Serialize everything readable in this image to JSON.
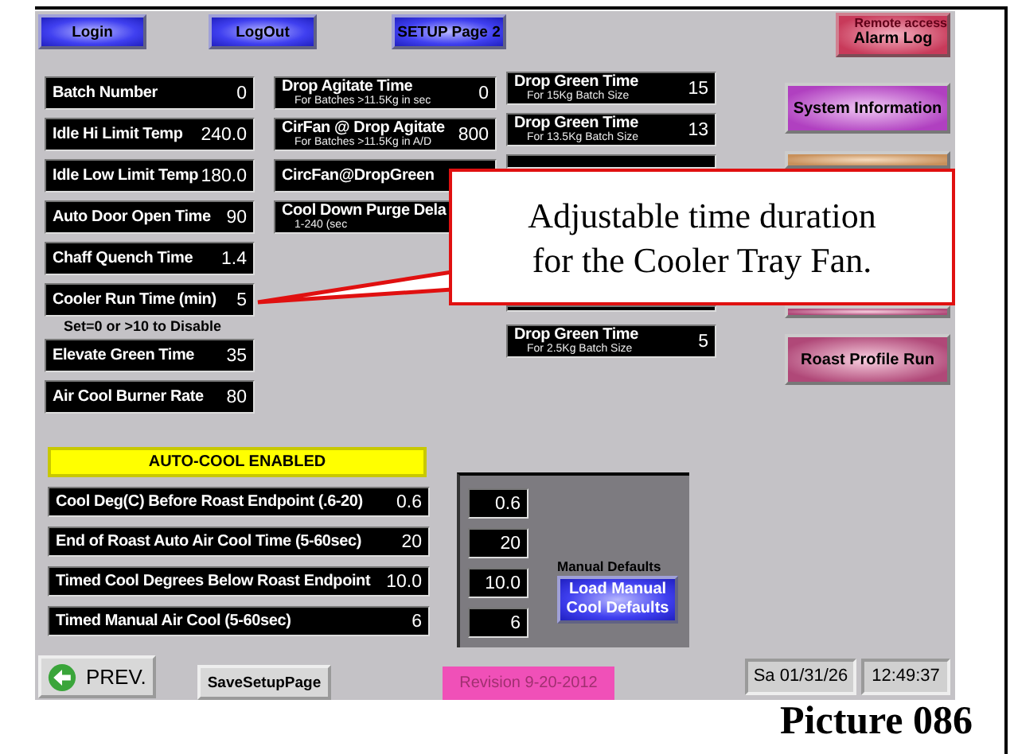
{
  "top_buttons": [
    {
      "label": "Login"
    },
    {
      "label": "LogOut"
    },
    {
      "label": "SETUP Page 2"
    }
  ],
  "alarm_button": {
    "caption": "Remote access",
    "label": "Alarm Log"
  },
  "settings_left": [
    {
      "label": "Batch Number",
      "value": "0"
    },
    {
      "label": "Idle Hi Limit Temp",
      "value": "240.0"
    },
    {
      "label": "Idle Low Limit Temp",
      "value": "180.0"
    },
    {
      "label": "Auto Door Open Time",
      "value": "90"
    },
    {
      "label": "Chaff Quench Time",
      "value": "1.4"
    },
    {
      "label": "Cooler Run Time (min)",
      "value": "5",
      "note": "Set=0 or >10 to Disable"
    },
    {
      "label": "Elevate Green Time",
      "value": "35"
    },
    {
      "label": "Air Cool Burner Rate",
      "value": "80"
    }
  ],
  "settings_middle": [
    {
      "label": "Drop Agitate Time",
      "sublabel": "For Batches >11.5Kg in sec",
      "value": "0"
    },
    {
      "label": "CirFan @ Drop Agitate",
      "sublabel": "For Batches >11.5Kg in A/D",
      "value": "800"
    },
    {
      "label": "CircFan@DropGreen"
    },
    {
      "label": "Cool Down Purge Dela",
      "sublabel": "1-240  (sec"
    }
  ],
  "drop_green_times": [
    {
      "label": "Drop Green Time",
      "sublabel": "For 15Kg Batch Size",
      "value": "15"
    },
    {
      "label": "Drop Green Time",
      "sublabel": "For 13.5Kg Batch Size",
      "value": "13"
    },
    {
      "kind": "covered_top"
    },
    {
      "kind": "covered_bottom"
    },
    {
      "label": "Drop Green Time",
      "sublabel": "For 2.5Kg Batch Size",
      "value": "5"
    }
  ],
  "side_buttons": [
    {
      "label": "System Information",
      "kind": "purple"
    },
    {
      "kind": "orange",
      "clipped_top": true
    },
    {
      "kind": "pink",
      "clipped_bottom": true
    },
    {
      "label": "Roast Profile Run",
      "kind": "pink"
    }
  ],
  "auto_cool": {
    "status": "AUTO-COOL ENABLED",
    "rows": [
      {
        "label": "Cool Deg(C) Before Roast Endpoint (.6-20)",
        "value": "0.6"
      },
      {
        "label": "End of Roast Auto Air Cool Time (5-60sec)",
        "value": "20"
      },
      {
        "label": "Timed Cool Degrees Below Roast Endpoint",
        "value": "10.0"
      },
      {
        "label": "Timed Manual Air Cool (5-60sec)",
        "value": "6"
      }
    ]
  },
  "manual_defaults": {
    "values": [
      "0.6",
      "20",
      "10.0",
      "6"
    ],
    "caption": "Manual Defaults",
    "button": "Load Manual Cool Defaults"
  },
  "footer": {
    "prev": "PREV.",
    "save": "SaveSetupPage",
    "revision": "Revision 9-20-2012",
    "date": "Sa 01/31/26",
    "time": "12:49:37"
  },
  "callout": "Adjustable time duration for the Cooler Tray Fan.",
  "caption": "Picture 086"
}
